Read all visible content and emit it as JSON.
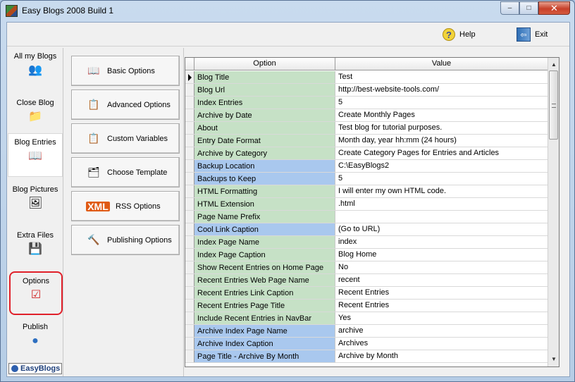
{
  "window": {
    "title": "Easy Blogs 2008 Build 1",
    "minimize": "–",
    "maximize": "□",
    "close": "✕"
  },
  "toolbar": {
    "help_label": "Help",
    "exit_label": "Exit"
  },
  "sidebar": {
    "items": [
      {
        "label": "All my Blogs",
        "icon": "people-icon"
      },
      {
        "label": "Close Blog",
        "icon": "folder-icon"
      },
      {
        "label": "Blog Entries",
        "icon": "book-icon"
      },
      {
        "label": "Blog Pictures",
        "icon": "picture-icon"
      },
      {
        "label": "Extra Files",
        "icon": "files-icon"
      },
      {
        "label": "Options",
        "icon": "checklist-icon"
      },
      {
        "label": "Publish",
        "icon": "globe-icon"
      }
    ],
    "logo_text": "EasyBlogs"
  },
  "options_menu": {
    "basic": "Basic Options",
    "advanced": "Advanced Options",
    "custom_vars": "Custom Variables",
    "template": "Choose Template",
    "rss_badge": "XML",
    "rss": "RSS Options",
    "publishing": "Publishing Options"
  },
  "grid": {
    "header_option": "Option",
    "header_value": "Value",
    "rows": [
      {
        "option": "Blog Title",
        "value": "Test",
        "shade": "green"
      },
      {
        "option": "Blog Url",
        "value": "http://best-website-tools.com/",
        "shade": "green"
      },
      {
        "option": "Index Entries",
        "value": "5",
        "shade": "green"
      },
      {
        "option": "Archive by Date",
        "value": "Create Monthly Pages",
        "shade": "green"
      },
      {
        "option": "About",
        "value": "Test blog for tutorial purposes.",
        "shade": "green"
      },
      {
        "option": "Entry Date Format",
        "value": "Month day, year hh:mm (24 hours)",
        "shade": "green"
      },
      {
        "option": "Archive by Category",
        "value": "Create Category Pages for Entries and Articles",
        "shade": "green"
      },
      {
        "option": "Backup Location",
        "value": "C:\\EasyBlogs2",
        "shade": "blue"
      },
      {
        "option": "Backups to Keep",
        "value": "5",
        "shade": "blue"
      },
      {
        "option": "HTML Formatting",
        "value": "I will enter my own HTML code.",
        "shade": "green"
      },
      {
        "option": "HTML Extension",
        "value": ".html",
        "shade": "green"
      },
      {
        "option": "Page Name Prefix",
        "value": "",
        "shade": "green"
      },
      {
        "option": "Cool Link Caption",
        "value": "(Go to URL)",
        "shade": "blue"
      },
      {
        "option": "Index Page Name",
        "value": "index",
        "shade": "green"
      },
      {
        "option": "Index Page Caption",
        "value": "Blog Home",
        "shade": "green"
      },
      {
        "option": "Show Recent Entries on Home Page",
        "value": "No",
        "shade": "green"
      },
      {
        "option": "Recent Entries Web Page Name",
        "value": "recent",
        "shade": "green"
      },
      {
        "option": "Recent Entries Link Caption",
        "value": "Recent Entries",
        "shade": "green"
      },
      {
        "option": "Recent Entries Page Title",
        "value": "Recent Entries",
        "shade": "green"
      },
      {
        "option": "Include Recent Entries in NavBar",
        "value": "Yes",
        "shade": "green"
      },
      {
        "option": "Archive Index Page Name",
        "value": "archive",
        "shade": "blue"
      },
      {
        "option": "Archive Index Caption",
        "value": "Archives",
        "shade": "blue"
      },
      {
        "option": "Page Title - Archive By Month",
        "value": "Archive by Month",
        "shade": "blue"
      }
    ]
  }
}
